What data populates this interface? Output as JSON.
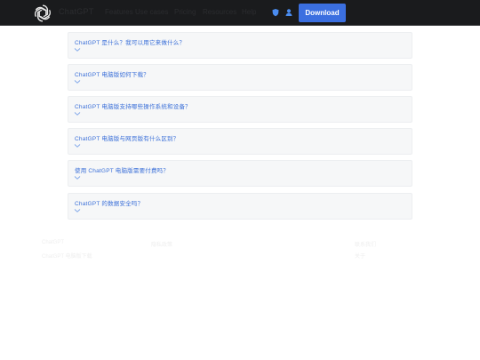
{
  "header": {
    "brand": "ChatGPT",
    "nav": [
      "Features",
      "Use cases",
      "Pricing",
      "Resources",
      "Help"
    ],
    "download_label": "Download"
  },
  "faq": {
    "items": [
      {
        "question": "ChatGPT 是什么？我可以用它来做什么？"
      },
      {
        "question": "ChatGPT 电脑版如何下载？"
      },
      {
        "question": "ChatGPT 电脑版支持哪些操作系统和设备？"
      },
      {
        "question": "ChatGPT 电脑版与网页版有什么区别？"
      },
      {
        "question": "使用 ChatGPT 电脑版需要付费吗？"
      },
      {
        "question": "ChatGPT 的数据安全吗？"
      }
    ]
  },
  "footer": {
    "col1": [
      "ChatGPT",
      "ChatGPT 电脑版下载"
    ],
    "col2": [
      "隐私政策"
    ],
    "col3": [
      "联系我们",
      "关于"
    ]
  }
}
